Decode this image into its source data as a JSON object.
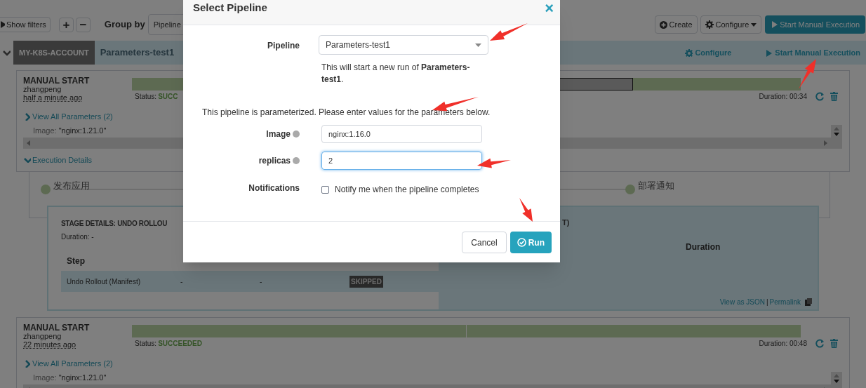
{
  "toolbar": {
    "show_filters": "Show filters",
    "zoom_in": "+",
    "zoom_out": "−",
    "group_by_label": "Group by",
    "group_by_value": "Pipeline",
    "buttons": [
      {
        "kind": "create",
        "label": "Create"
      },
      {
        "kind": "configure",
        "label": "Configure"
      },
      {
        "kind": "start",
        "label": "Start Manual Execution"
      }
    ]
  },
  "pipeline_header": {
    "expanded": true,
    "account": "MY-K8S-ACCOUNT",
    "name": "Parameters-test1",
    "actions": [
      {
        "kind": "configure",
        "label": "Configure"
      },
      {
        "kind": "start",
        "label": "Start Manual Execution"
      }
    ]
  },
  "executions": [
    {
      "trigger": "MANUAL START",
      "user": "zhangpeng",
      "time": "half a minute ago",
      "params_link": "View All Parameters (2)",
      "params_expanded": false,
      "param_key": "Image:",
      "param_value": "\"nginx:1.21.0\"",
      "status_label": "Status:",
      "status": "SUCC",
      "duration": "Duration: 00:34",
      "details_label": "Execution Details",
      "details_expanded": true,
      "segments": [
        {
          "kind": "succeeded",
          "selected": false
        },
        {
          "kind": "skipped",
          "selected": true
        },
        {
          "kind": "succeeded",
          "selected": false
        }
      ]
    },
    {
      "trigger": "MANUAL START",
      "user": "zhangpeng",
      "time": "22 minutes ago",
      "params_link": "View All Parameters (2)",
      "params_expanded": false,
      "param_key": "Image:",
      "param_value": "\"nginx:1.21.0\"",
      "status_label": "Status:",
      "status": "SUCCEEDED",
      "duration": "Duration: 00:48",
      "segments": [
        {
          "kind": "succeeded",
          "selected": false
        },
        {
          "kind": "succeeded",
          "selected": false
        }
      ]
    }
  ],
  "graph": {
    "nodes": [
      {
        "label": "发布应用"
      },
      {
        "label": "部署通知"
      }
    ]
  },
  "stage_details": {
    "title": "STAGE DETAILS: UNDO ROLLOU",
    "title_tail": "T)",
    "duration": "Duration: -",
    "columns": [
      "Step",
      "Duration"
    ],
    "rows": [
      {
        "cells": [
          "Undo Rollout (Manifest)",
          "-",
          "-"
        ],
        "status": "SKIPPED"
      }
    ],
    "links": [
      "View as JSON",
      "Permalink"
    ],
    "separator": "|"
  },
  "dialog": {
    "title": "Select Pipeline",
    "close": "×",
    "pipeline_label": "Pipeline",
    "pipeline_value": "Parameters-test1",
    "description": "This will start a new run of **Parameters-test1**.",
    "note": "This pipeline is parameterized. Please enter values for the parameters below.",
    "fields": [
      {
        "label": "Image",
        "value": "nginx:1.16.0",
        "focused": false
      },
      {
        "label": "replicas",
        "value": "2",
        "focused": true
      }
    ],
    "notifications_label": "Notifications",
    "notify": {
      "label": "Notify me when the pipeline completes",
      "checked": false
    },
    "buttons": [
      {
        "kind": "cancel",
        "label": "Cancel"
      },
      {
        "kind": "run",
        "label": "Run"
      }
    ]
  }
}
